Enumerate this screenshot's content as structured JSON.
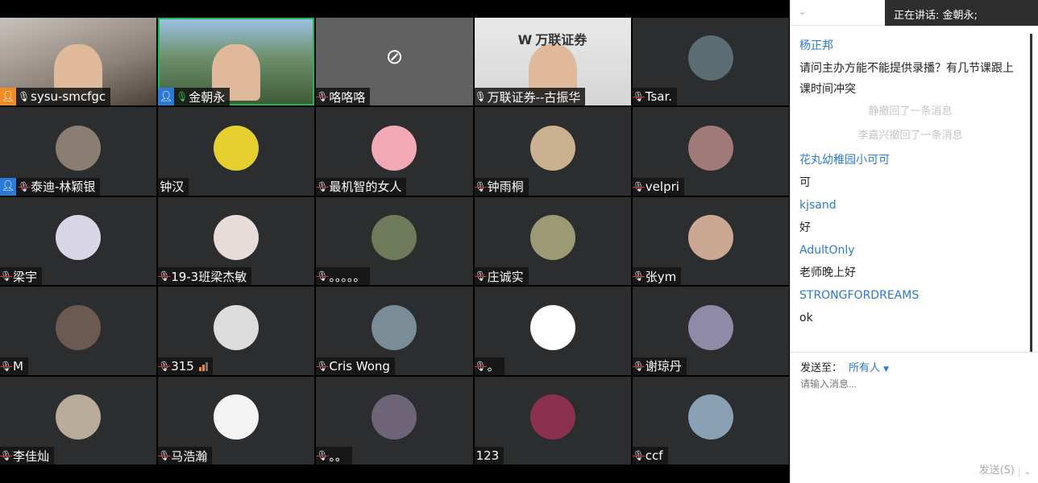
{
  "participants": [
    {
      "name": "sysu-smcfgc",
      "badge": "#f08a24",
      "mic": "on",
      "video": "v1"
    },
    {
      "name": "金朝永",
      "badge": "#2b79d8",
      "mic": "on-green",
      "video": "v2",
      "active": true
    },
    {
      "name": "咯咯咯",
      "mic": "muted",
      "camoff": true
    },
    {
      "name": "万联证券--古振华",
      "mic": "on",
      "video": "v4",
      "logo": "W",
      "logo_text": "万联证券"
    },
    {
      "name": "Tsar.",
      "mic": "muted",
      "avatar": "#5b6c72"
    },
    {
      "name": "泰迪-林颖银",
      "badge": "#2b79d8",
      "mic": "muted",
      "avatar": "#8a7d72"
    },
    {
      "name": "钟汉",
      "mic": "none",
      "avatar": "#e6d030"
    },
    {
      "name": "最机智的女人",
      "mic": "muted",
      "avatar": "#f2a9b5"
    },
    {
      "name": "钟雨桐",
      "mic": "muted",
      "avatar": "#c9b08f"
    },
    {
      "name": "velpri",
      "mic": "muted",
      "avatar": "#a07a78"
    },
    {
      "name": "梁宇",
      "mic": "muted",
      "avatar": "#d8d6e4"
    },
    {
      "name": "19-3班梁杰敏",
      "mic": "muted",
      "avatar": "#e8dcd8"
    },
    {
      "name": "。。。。。",
      "mic": "muted",
      "avatar": "#6f7a5a"
    },
    {
      "name": "庄诚实",
      "mic": "muted",
      "avatar": "#9c9a74"
    },
    {
      "name": "张ym",
      "mic": "muted",
      "avatar": "#caa894"
    },
    {
      "name": "M",
      "mic": "muted",
      "avatar": "#6a5a52"
    },
    {
      "name": "315",
      "mic": "muted",
      "avatar": "#dcdcdc",
      "signal": true
    },
    {
      "name": "Cris Wong",
      "mic": "muted",
      "avatar": "#7a8c96"
    },
    {
      "name": "。",
      "mic": "muted",
      "avatar": "#ffffff"
    },
    {
      "name": "谢琼丹",
      "mic": "muted",
      "avatar": "#8f8aa8"
    },
    {
      "name": "李佳灿",
      "mic": "muted",
      "avatar": "#b9ab9a"
    },
    {
      "name": "马浩瀚",
      "mic": "muted",
      "avatar": "#f4f4f4"
    },
    {
      "name": "。。",
      "mic": "muted",
      "avatar": "#6d6478"
    },
    {
      "name": "123",
      "mic": "none",
      "avatar": "#8c3050"
    },
    {
      "name": "ccf",
      "mic": "muted",
      "avatar": "#8aa0b4"
    }
  ],
  "chat": {
    "speaking": "正在讲话: 金朝永;",
    "messages": [
      {
        "sender": "杨正邦",
        "text": "请问主办方能不能提供录播？有几节课跟上课时间冲突"
      },
      {
        "recall": "静撤回了一条消息"
      },
      {
        "recall": "李嘉兴撤回了一条消息"
      },
      {
        "sender": "花丸幼稚园小可可",
        "text": "可"
      },
      {
        "sender": "kjsand",
        "text": "好"
      },
      {
        "sender": "AdultOnly",
        "text": "老师晚上好"
      },
      {
        "sender": "STRONGFORDREAMS",
        "text": "ok"
      }
    ],
    "send_to_label": "发送至：",
    "send_to_value": "所有人",
    "input_placeholder": "请输入消息...",
    "send_button": "发送(S)"
  },
  "colors": {
    "accent": "#2b79d8",
    "active_speaker": "#1db954",
    "muted": "#d33"
  }
}
